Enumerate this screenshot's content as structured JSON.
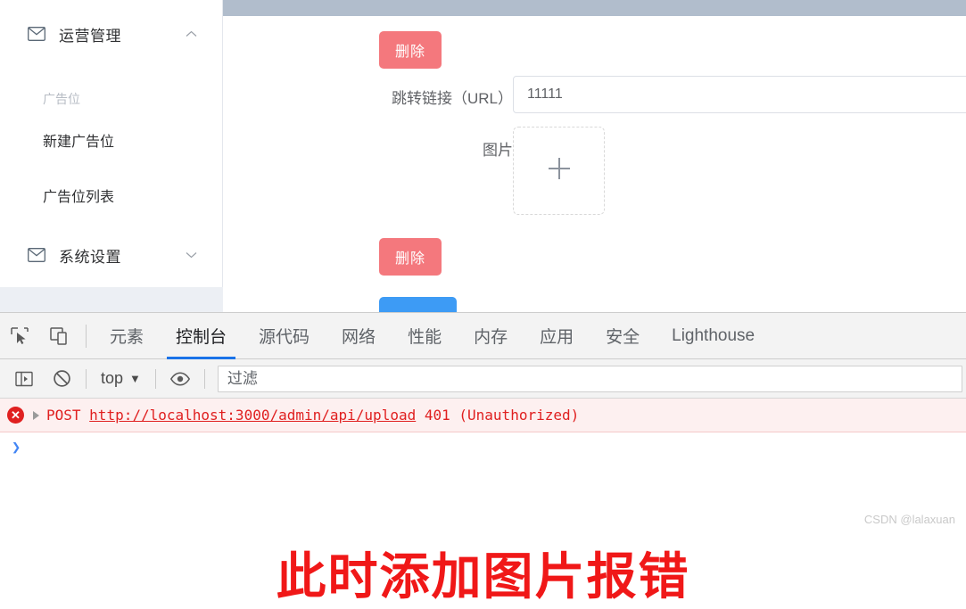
{
  "app": {
    "sidebar": {
      "groups": [
        {
          "label": "运营管理",
          "icon": "mail-icon",
          "arrow": "chevron-up-icon",
          "expanded": true
        },
        {
          "label": "系统设置",
          "icon": "mail-icon",
          "arrow": "chevron-down-icon",
          "expanded": false
        }
      ],
      "submenu": [
        {
          "label": "广告位",
          "muted": true
        },
        {
          "label": "新建广告位",
          "muted": false
        },
        {
          "label": "广告位列表",
          "muted": false
        }
      ]
    },
    "form": {
      "delete_label_top": "删除",
      "delete_label_bottom": "删除",
      "url_label": "跳转链接（URL）",
      "url_value": "11111",
      "image_label": "图片",
      "upload_plus": "+"
    },
    "colors": {
      "topbar": "#b1bdcc",
      "danger": "#f4787d",
      "primary": "#3d9bf5",
      "error_red": "#e02020",
      "annotation_red": "#f01818",
      "devtools_accent": "#1a73e8"
    }
  },
  "devtools": {
    "toolbar_icons": [
      {
        "name": "inspect-element-icon"
      },
      {
        "name": "device-toolbar-icon"
      }
    ],
    "tabs": [
      {
        "label": "元素",
        "active": false
      },
      {
        "label": "控制台",
        "active": true
      },
      {
        "label": "源代码",
        "active": false
      },
      {
        "label": "网络",
        "active": false
      },
      {
        "label": "性能",
        "active": false
      },
      {
        "label": "内存",
        "active": false
      },
      {
        "label": "应用",
        "active": false
      },
      {
        "label": "安全",
        "active": false
      },
      {
        "label": "Lighthouse",
        "active": false
      }
    ],
    "filterbar": {
      "sidebar_toggle_icon": "console-sidebar-icon",
      "clear_icon": "clear-console-icon",
      "context": "top",
      "context_arrow": "▼",
      "eye_icon": "live-expression-eye-icon",
      "filter_placeholder": "过滤",
      "filter_value": ""
    },
    "console": {
      "error": {
        "icon": "error-circle-icon",
        "icon_glyph": "✕",
        "expand_icon": "expand-triangle-icon",
        "method": "POST",
        "url": "http://localhost:3000/admin/api/upload",
        "status": "401 (Unauthorized)"
      },
      "prompt_chevron": "❯"
    }
  },
  "overlay": {
    "annotation": "此时添加图片报错",
    "watermark": "CSDN @lalaxuan"
  }
}
